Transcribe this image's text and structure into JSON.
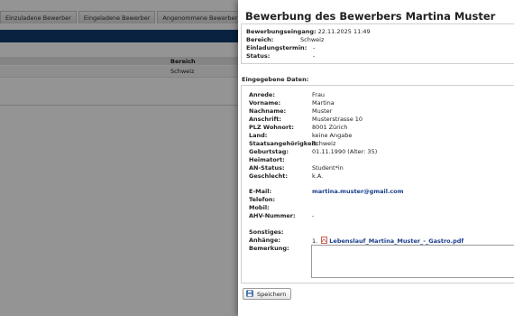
{
  "background": {
    "tabs": [
      "Einzuladene Bewerber",
      "Eingeladene Bewerber",
      "Angenommene Bewerber"
    ],
    "table_header": {
      "bereich": "Bereich"
    },
    "row": {
      "bereich": "Schweiz"
    }
  },
  "dialog": {
    "title": "Bewerbung des Bewerbers Martina Muster",
    "summary": [
      {
        "label": "Bewerbungseingang:",
        "value": "22.11.2025 11:49"
      },
      {
        "label": "Bereich:",
        "value": "Schweiz"
      },
      {
        "label": "Einladungstermin:",
        "value": "-"
      },
      {
        "label": "Status:",
        "value": "-"
      }
    ],
    "section_title": "Eingegebene Daten:",
    "fields": [
      {
        "label": "Anrede:",
        "value": "Frau"
      },
      {
        "label": "Vorname:",
        "value": "Martina"
      },
      {
        "label": "Nachname:",
        "value": "Muster"
      },
      {
        "label": "Anschrift:",
        "value": "Musterstrasse 10"
      },
      {
        "label": "PLZ Wohnort:",
        "value": "8001 Zürich"
      },
      {
        "label": "Land:",
        "value": "keine Angabe"
      },
      {
        "label": "Staatsangehörigkeit:",
        "value": "Schweiz"
      },
      {
        "label": "Geburtstag:",
        "value": "01.11.1990 (Alter: 35)"
      },
      {
        "label": "Heimatort:",
        "value": ""
      },
      {
        "label": "AN-Status:",
        "value": "Student*in"
      },
      {
        "label": "Geschlecht:",
        "value": "k.A."
      }
    ],
    "contact": [
      {
        "label": "E-Mail:",
        "value": "martina.muster@gmail.com"
      },
      {
        "label": "Telefon:",
        "value": ""
      },
      {
        "label": "Mobil:",
        "value": ""
      },
      {
        "label": "AHV-Nummer:",
        "value": "-"
      }
    ],
    "sonstiges_label": "Sonstiges:",
    "anhaenge_label": "Anhänge:",
    "attachment_index": "1.",
    "attachment_name": "Lebenslauf_Martina_Muster_-_Gastro.pdf",
    "bemerkung_label": "Bemerkung:",
    "save_label": "Speichern",
    "colors": {
      "header_bar": "#0f3c6e",
      "link": "#1a3d8c",
      "overlay": "rgba(0,0,0,0.42)"
    },
    "icons": {
      "attachment": "pdf-icon",
      "save": "floppy-disk-icon"
    }
  }
}
